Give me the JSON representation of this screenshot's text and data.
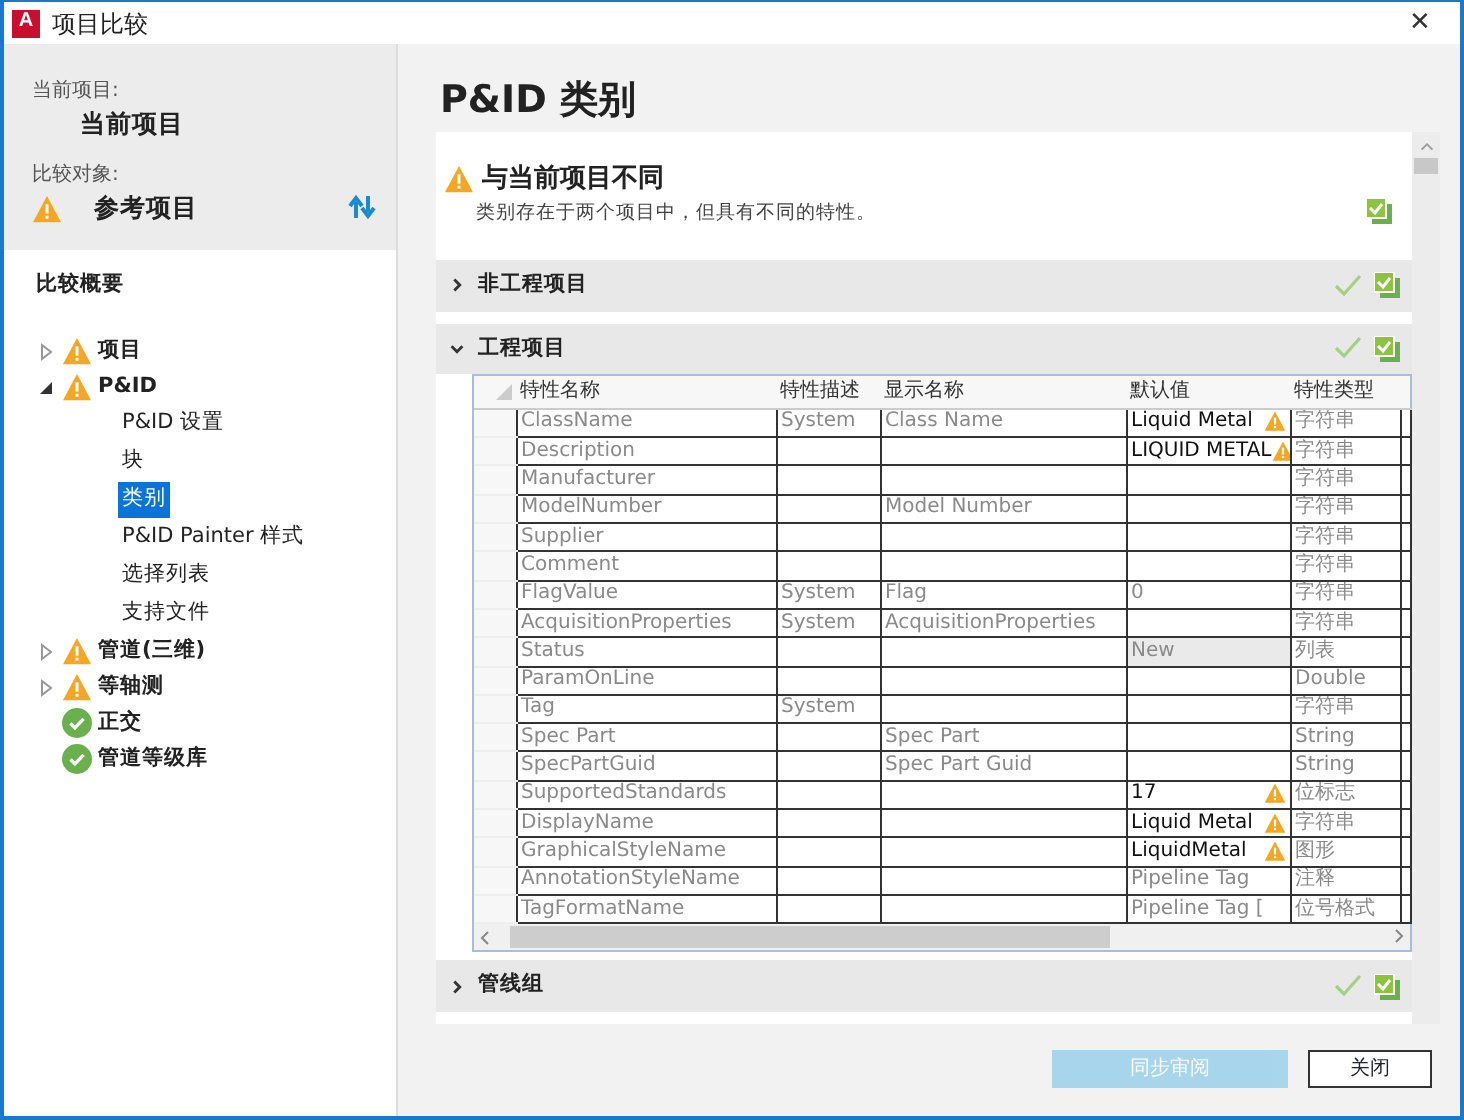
{
  "window": {
    "logo_letter": "A",
    "title": "项目比较",
    "close_glyph": "✕"
  },
  "sidebar": {
    "current_label": "当前项目:",
    "current_value": "当前项目",
    "compare_label": "比较对象:",
    "compare_value": "参考项目",
    "compare_warning": true,
    "summary_title": "比较概要",
    "tree": [
      {
        "label": "项目",
        "kind": "warning",
        "expanded": false,
        "selected": false
      },
      {
        "label": "P&ID",
        "kind": "warning",
        "expanded": true,
        "selected": false,
        "children": [
          {
            "label": "P&ID 设置",
            "selected": false
          },
          {
            "label": "块",
            "selected": false
          },
          {
            "label": "类别",
            "selected": true
          },
          {
            "label": "P&ID Painter 样式",
            "selected": false
          },
          {
            "label": "选择列表",
            "selected": false
          },
          {
            "label": "支持文件",
            "selected": false
          }
        ]
      },
      {
        "label": "管道(三维)",
        "kind": "warning",
        "expanded": false,
        "selected": false
      },
      {
        "label": "等轴测",
        "kind": "warning",
        "expanded": false,
        "selected": false
      },
      {
        "label": "正交",
        "kind": "ok",
        "selected": false
      },
      {
        "label": "管道等级库",
        "kind": "ok",
        "selected": false
      }
    ]
  },
  "main": {
    "heading": "P&ID 类别",
    "notice": {
      "title": "与当前项目不同",
      "text": "类别存在于两个项目中，但具有不同的特性。",
      "warning": true
    },
    "sections": [
      {
        "title": "非工程项目",
        "expanded": false
      },
      {
        "title": "工程项目",
        "expanded": true,
        "table": {
          "columns": [
            "特性名称",
            "特性描述",
            "显示名称",
            "默认值",
            "特性类型"
          ],
          "rows": [
            {
              "name": "ClassName",
              "description": "System",
              "display_name": "Class Name",
              "default_value": "Liquid Metal",
              "type": "字符串",
              "changed": true,
              "shaded": false
            },
            {
              "name": "Description",
              "description": "",
              "display_name": "",
              "default_value": "LIQUID METAL",
              "type": "字符串",
              "changed": true,
              "shaded": false
            },
            {
              "name": "Manufacturer",
              "description": "",
              "display_name": "",
              "default_value": "",
              "type": "字符串",
              "changed": false,
              "shaded": false
            },
            {
              "name": "ModelNumber",
              "description": "",
              "display_name": "Model Number",
              "default_value": "",
              "type": "字符串",
              "changed": false,
              "shaded": false
            },
            {
              "name": "Supplier",
              "description": "",
              "display_name": "",
              "default_value": "",
              "type": "字符串",
              "changed": false,
              "shaded": false
            },
            {
              "name": "Comment",
              "description": "",
              "display_name": "",
              "default_value": "",
              "type": "字符串",
              "changed": false,
              "shaded": false
            },
            {
              "name": "FlagValue",
              "description": "System",
              "display_name": "Flag",
              "default_value": "0",
              "type": "字符串",
              "changed": false,
              "shaded": false
            },
            {
              "name": "AcquisitionProperties",
              "description": "System",
              "display_name": "AcquisitionProperties",
              "default_value": "",
              "type": "字符串",
              "changed": false,
              "shaded": false
            },
            {
              "name": "Status",
              "description": "",
              "display_name": "",
              "default_value": "New",
              "type": "列表",
              "changed": false,
              "shaded": true
            },
            {
              "name": "ParamOnLine",
              "description": "",
              "display_name": "",
              "default_value": "",
              "type": "Double",
              "changed": false,
              "shaded": false
            },
            {
              "name": "Tag",
              "description": "System",
              "display_name": "",
              "default_value": "",
              "type": "字符串",
              "changed": false,
              "shaded": false
            },
            {
              "name": "Spec Part",
              "description": "",
              "display_name": "Spec Part",
              "default_value": "",
              "type": "String",
              "changed": false,
              "shaded": false
            },
            {
              "name": "SpecPartGuid",
              "description": "",
              "display_name": "Spec Part Guid",
              "default_value": "",
              "type": "String",
              "changed": false,
              "shaded": false
            },
            {
              "name": "SupportedStandards",
              "description": "",
              "display_name": "",
              "default_value": "17",
              "type": "位标志",
              "changed": true,
              "shaded": false
            },
            {
              "name": "DisplayName",
              "description": "",
              "display_name": "",
              "default_value": "Liquid Metal",
              "type": "字符串",
              "changed": true,
              "shaded": false
            },
            {
              "name": "GraphicalStyleName",
              "description": "",
              "display_name": "",
              "default_value": "LiquidMetal",
              "type": "图形",
              "changed": true,
              "shaded": false
            },
            {
              "name": "AnnotationStyleName",
              "description": "",
              "display_name": "",
              "default_value": "Pipeline Tag",
              "type": "注释",
              "changed": false,
              "shaded": false
            },
            {
              "name": "TagFormatName",
              "description": "",
              "display_name": "",
              "default_value": "Pipeline Tag [",
              "type": "位号格式",
              "changed": false,
              "shaded": false
            }
          ]
        }
      },
      {
        "title": "管线组",
        "expanded": false
      }
    ]
  },
  "buttons": [
    {
      "label": "同步审阅",
      "disabled": true
    },
    {
      "label": "关闭",
      "disabled": false
    }
  ]
}
